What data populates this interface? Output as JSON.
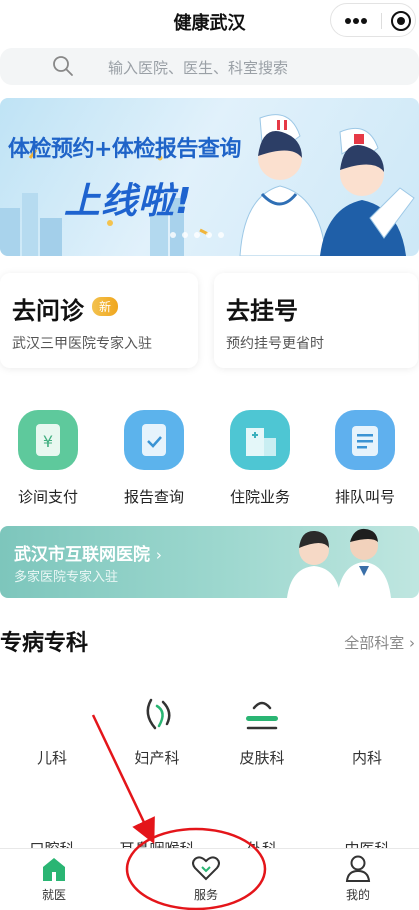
{
  "nav": {
    "title": "健康武汉"
  },
  "search": {
    "placeholder": "输入医院、医生、科室搜索"
  },
  "banner": {
    "line1": "体检预约+体检报告查询",
    "line2": "上线啦!"
  },
  "cards": [
    {
      "title": "去问诊",
      "badge": "新",
      "subtitle": "武汉三甲医院专家入驻"
    },
    {
      "title": "去挂号",
      "subtitle": "预约挂号更省时"
    }
  ],
  "services": [
    {
      "label": "诊间支付",
      "icon": "payment-icon",
      "color": "#5ec99c"
    },
    {
      "label": "报告查询",
      "icon": "report-icon",
      "color": "#5cb3ec"
    },
    {
      "label": "住院业务",
      "icon": "hospital-icon",
      "color": "#4ec6d3"
    },
    {
      "label": "排队叫号",
      "icon": "queue-icon",
      "color": "#5fb0ee"
    }
  ],
  "hospital": {
    "title": "武汉市互联网医院",
    "subtitle": "多家医院专家入驻"
  },
  "section": {
    "title": "专病专科",
    "more": "全部科室"
  },
  "departments_row1": [
    "儿科",
    "妇产科",
    "皮肤科",
    "内科"
  ],
  "departments_row2": [
    "口腔科",
    "耳鼻咽喉科",
    "外科",
    "中医科"
  ],
  "tabs": [
    {
      "label": "就医",
      "icon": "home-icon",
      "active": true
    },
    {
      "label": "服务",
      "icon": "heart-icon",
      "active": false
    },
    {
      "label": "我的",
      "icon": "user-icon",
      "active": false
    }
  ],
  "colors": {
    "accent": "#2ab573",
    "annotation": "#e4151a",
    "brand_blue": "#1e63cf"
  }
}
